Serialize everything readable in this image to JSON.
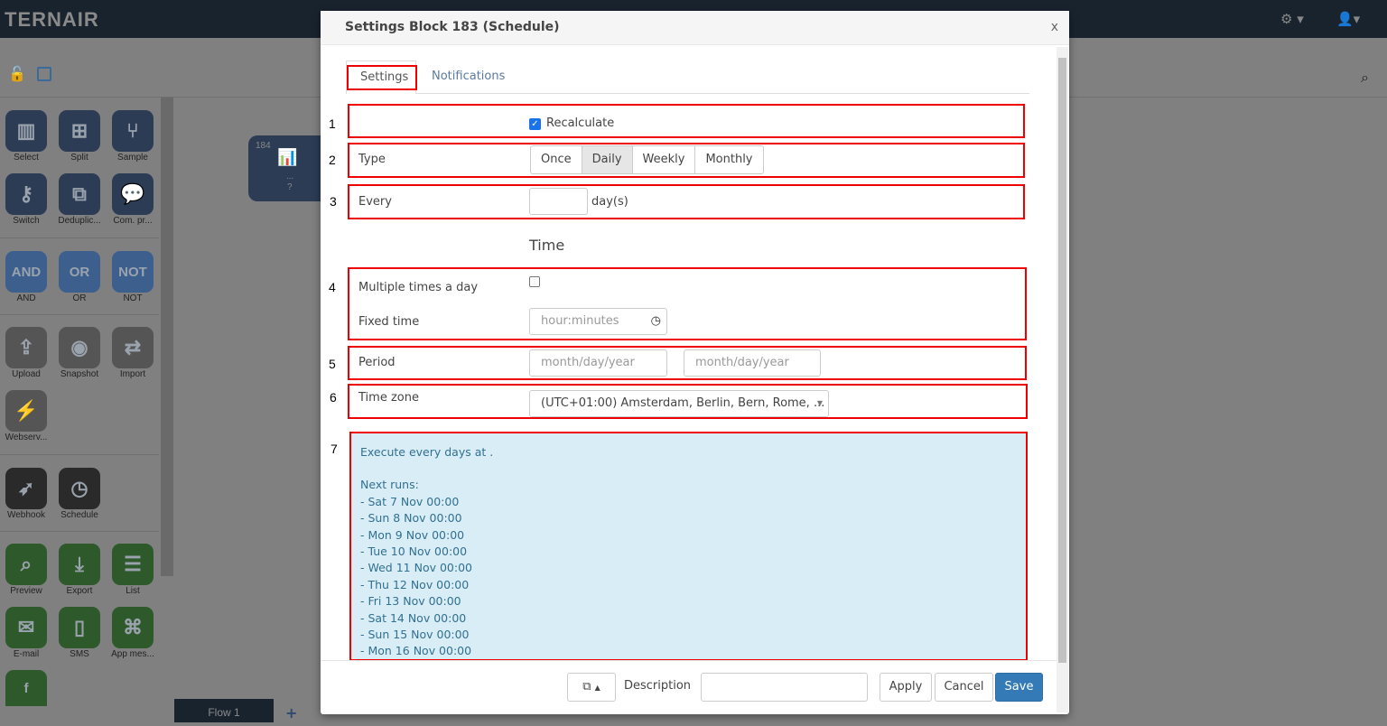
{
  "app": {
    "logo": "TERNAIR"
  },
  "sidebar": {
    "tiles": [
      {
        "label": "Select",
        "icon": "bar-chart-icon"
      },
      {
        "label": "Split",
        "icon": "sitemap-icon"
      },
      {
        "label": "Sample",
        "icon": "branch-icon"
      },
      {
        "label": "Switch",
        "icon": "key-icon"
      },
      {
        "label": "Deduplic...",
        "icon": "copy-icon"
      },
      {
        "label": "Com. pr...",
        "icon": "comments-icon"
      },
      {
        "label": "AND",
        "text": "AND"
      },
      {
        "label": "OR",
        "text": "OR"
      },
      {
        "label": "NOT",
        "text": "NOT"
      },
      {
        "label": "Upload",
        "icon": "upload-icon"
      },
      {
        "label": "Snapshot",
        "icon": "camera-icon"
      },
      {
        "label": "Import",
        "icon": "exchange-icon"
      },
      {
        "label": "Webserv...",
        "icon": "plug-icon"
      },
      {
        "label": "Webhook",
        "icon": "rocket-icon"
      },
      {
        "label": "Schedule",
        "icon": "clock-icon"
      },
      {
        "label": "Preview",
        "icon": "search-icon"
      },
      {
        "label": "Export",
        "icon": "download-icon"
      },
      {
        "label": "List",
        "icon": "list-icon"
      },
      {
        "label": "E-mail",
        "icon": "envelope-icon"
      },
      {
        "label": "SMS",
        "icon": "mobile-icon"
      },
      {
        "label": "App mes...",
        "icon": "android-apple-icon"
      }
    ]
  },
  "canvas": {
    "node_id": "184",
    "node_label": "...",
    "node_status": "?",
    "flow_tab": "Flow 1",
    "add_tab": "+"
  },
  "modal": {
    "title": "Settings Block 183 (Schedule)",
    "close": "x",
    "tabs": [
      "Settings",
      "Notifications"
    ],
    "row_numbers": [
      "1",
      "2",
      "3",
      "4",
      "5",
      "6",
      "7"
    ],
    "recalculate_label": "Recalculate",
    "recalculate_checked": true,
    "type_label": "Type",
    "type_options": [
      "Once",
      "Daily",
      "Weekly",
      "Monthly"
    ],
    "type_selected": "Daily",
    "every_label": "Every",
    "every_value": "",
    "every_unit": "day(s)",
    "time_heading": "Time",
    "multiple_label": "Multiple times a day",
    "multiple_checked": false,
    "fixed_time_label": "Fixed time",
    "fixed_time_placeholder": "hour:minutes",
    "period_label": "Period",
    "period_start_placeholder": "month/day/year",
    "period_end_placeholder": "month/day/year",
    "timezone_label": "Time zone",
    "timezone_value": "(UTC+01:00) Amsterdam, Berlin, Bern, Rome, ...",
    "summary": "Execute every days at .",
    "next_runs_label": "Next runs:",
    "next_runs": [
      "- Sat 7 Nov 00:00",
      "- Sun 8 Nov 00:00",
      "- Mon 9 Nov 00:00",
      "- Tue 10 Nov 00:00",
      "- Wed 11 Nov 00:00",
      "- Thu 12 Nov 00:00",
      "- Fri 13 Nov 00:00",
      "- Sat 14 Nov 00:00",
      "- Sun 15 Nov 00:00",
      "- Mon 16 Nov 00:00"
    ],
    "footer": {
      "description_label": "Description",
      "description_value": "",
      "apply": "Apply",
      "cancel": "Cancel",
      "save": "Save"
    }
  },
  "colors": {
    "accent": "#337ab7",
    "highlight": "#ee0000",
    "info_bg": "#d9edf7"
  }
}
